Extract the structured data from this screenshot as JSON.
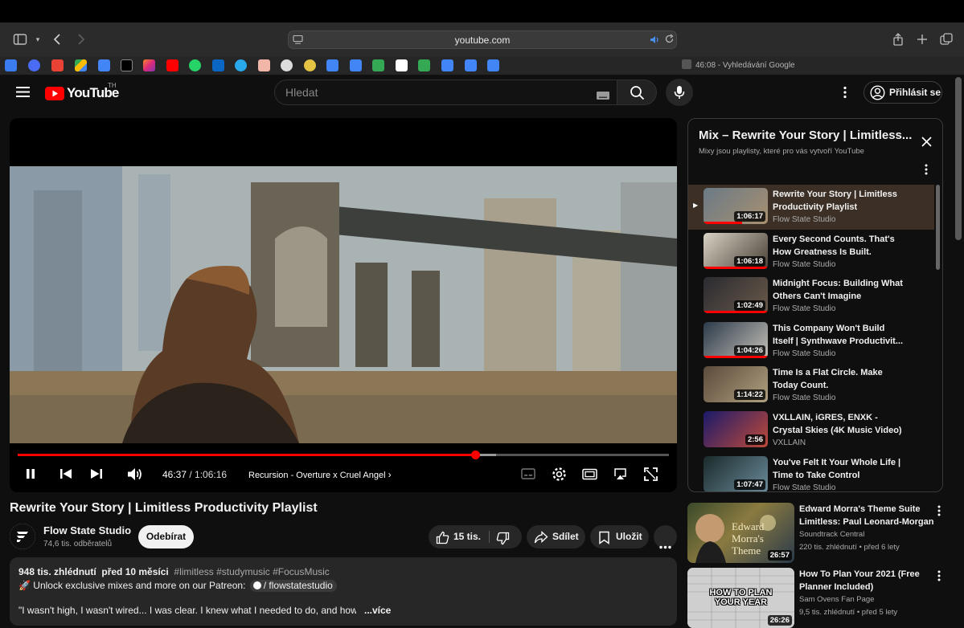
{
  "browser": {
    "url": "youtube.com",
    "bookmark_right_label": "46:08 - Vyhledávání Google"
  },
  "header": {
    "logo_text": "YouTube",
    "region": "TH",
    "search_placeholder": "Hledat",
    "signin_label": "Přihlásit se"
  },
  "player": {
    "time_current": "46:37",
    "time_sep": " / ",
    "time_total": "1:06:16",
    "progress_fraction": 0.703,
    "buffered_fraction": 0.735,
    "chapter": "Recursion - Overture x Cruel Angel"
  },
  "video": {
    "title": "Rewrite Your Story | Limitless Productivity Playlist",
    "channel": "Flow State Studio",
    "subscribers": "74,6 tis. odběratelů",
    "subscribe_label": "Odebírat",
    "likes": "15 tis.",
    "share_label": "Sdílet",
    "save_label": "Uložit",
    "views": "948 tis. zhlédnutí",
    "age": "před 10 měsíci",
    "hashtags": "#limitless #studymusic #FocusMusic",
    "desc_line1_prefix": "🚀 Unlock exclusive mixes and more on our Patreon:",
    "desc_line1_link": "/ flowstatestudio",
    "desc_line2": "\"I wasn't high, I wasn't wired... I was clear. I knew what I needed to do, and how to do it.\"",
    "more_label": "...více"
  },
  "playlist": {
    "title": "Mix – Rewrite Your Story | Limitless...",
    "subtitle": "Mixy jsou playlisty, které pro vás vytvoří YouTube",
    "items": [
      {
        "title": "Rewrite Your Story | Limitless Productivity Playlist",
        "channel": "Flow State Studio",
        "duration": "1:06:17",
        "active": true
      },
      {
        "title": "Every Second Counts. That's How Greatness Is Built.",
        "channel": "Flow State Studio",
        "duration": "1:06:18"
      },
      {
        "title": "Midnight Focus: Building What Others Can't Imagine",
        "channel": "Flow State Studio",
        "duration": "1:02:49"
      },
      {
        "title": "This Company Won't Build Itself | Synthwave Productivit...",
        "channel": "Flow State Studio",
        "duration": "1:04:26"
      },
      {
        "title": "Time Is a Flat Circle. Make Today Count.",
        "channel": "Flow State Studio",
        "duration": "1:14:22"
      },
      {
        "title": "VXLLAIN, iGRES, ENXK - Crystal Skies (4K Music Video)",
        "channel": "VXLLAIN",
        "duration": "2:56"
      },
      {
        "title": "You've Felt It Your Whole Life | Time to Take Control",
        "channel": "Flow State Studio",
        "duration": "1:07:47"
      }
    ]
  },
  "related": [
    {
      "title": "Edward Morra's Theme Suite Limitless: Paul Leonard-Morgan",
      "channel": "Soundtrack Central",
      "views": "220 tis. zhlédnutí",
      "age": "před 6 lety",
      "duration": "26:57",
      "thumb_text": "Edward Morra's Theme"
    },
    {
      "title": "How To Plan Your 2021 (Free Planner Included)",
      "channel": "Sam Ovens Fan Page",
      "views": "9,5 tis. zhlédnutí",
      "age": "před 5 lety",
      "duration": "26:26",
      "thumb_text": "HOW TO PLAN YOUR YEAR"
    }
  ],
  "colors": {
    "accent_red": "#ff0000",
    "background": "#0f0f0f"
  }
}
